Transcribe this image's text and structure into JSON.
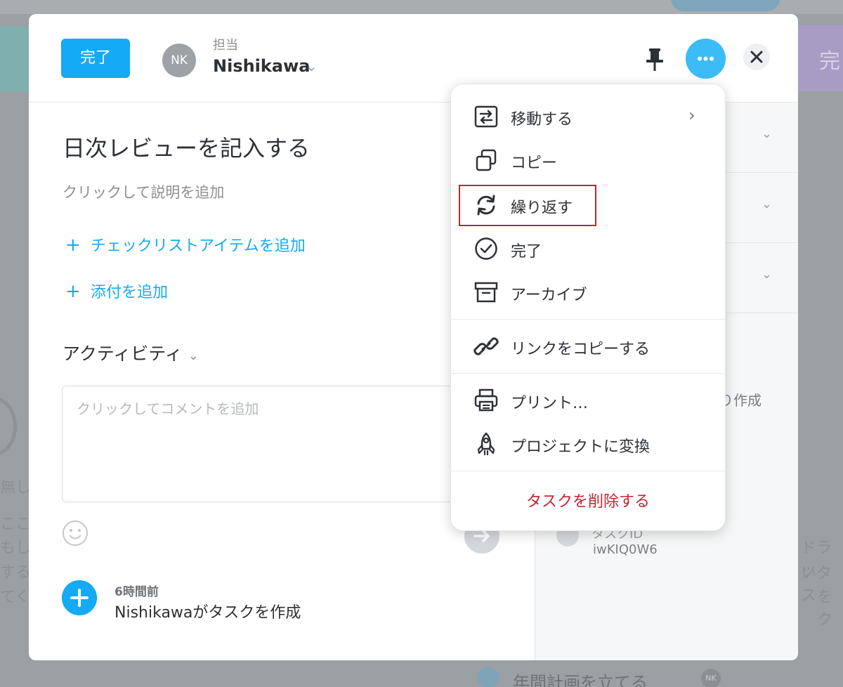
{
  "header": {
    "complete_label": "完了",
    "avatar_initials": "NK",
    "assignee_label": "担当",
    "assignee_name": "Nishikawa"
  },
  "task": {
    "title": "日次レビューを記入する",
    "description_placeholder": "クリックして説明を追加",
    "add_checklist_label": "チェックリストアイテムを追加",
    "add_attachment_label": "添付を追加",
    "plus_glyph": "+"
  },
  "activity": {
    "title": "アクティビティ",
    "comment_placeholder": "クリックしてコメントを追加",
    "story_time": "6時間前",
    "story_text": "Nishikawaがタスクを作成"
  },
  "sidebar": {
    "created_text": "り作成",
    "task_id_label": "タスクID",
    "task_id": "iwKIQ0W6"
  },
  "menu": {
    "items": [
      {
        "label": "移動する",
        "icon": "move-icon"
      },
      {
        "label": "コピー",
        "icon": "copy-icon"
      },
      {
        "label": "繰り返す",
        "icon": "repeat-icon"
      },
      {
        "label": "完了",
        "icon": "check-circle-icon"
      },
      {
        "label": "アーカイブ",
        "icon": "archive-icon"
      },
      {
        "label": "リンクをコピーする",
        "icon": "link-icon"
      },
      {
        "label": "プリント…",
        "icon": "printer-icon"
      },
      {
        "label": "プロジェクトに変換",
        "icon": "rocket-icon"
      }
    ],
    "delete_label": "タスクを削除する"
  },
  "background": {
    "purple_card_text": "完",
    "bottom_task": "年間計画を立てる",
    "bottom_avatar": "NK",
    "left_texts": [
      "無し",
      "ここ",
      "もし",
      "するた",
      "てくた"
    ],
    "right_texts": [
      "ドラッ",
      "いタス",
      "をク"
    ]
  },
  "colors": {
    "accent": "#14aaf5",
    "delete_red": "#c42431",
    "highlight_red": "#c0272d"
  }
}
